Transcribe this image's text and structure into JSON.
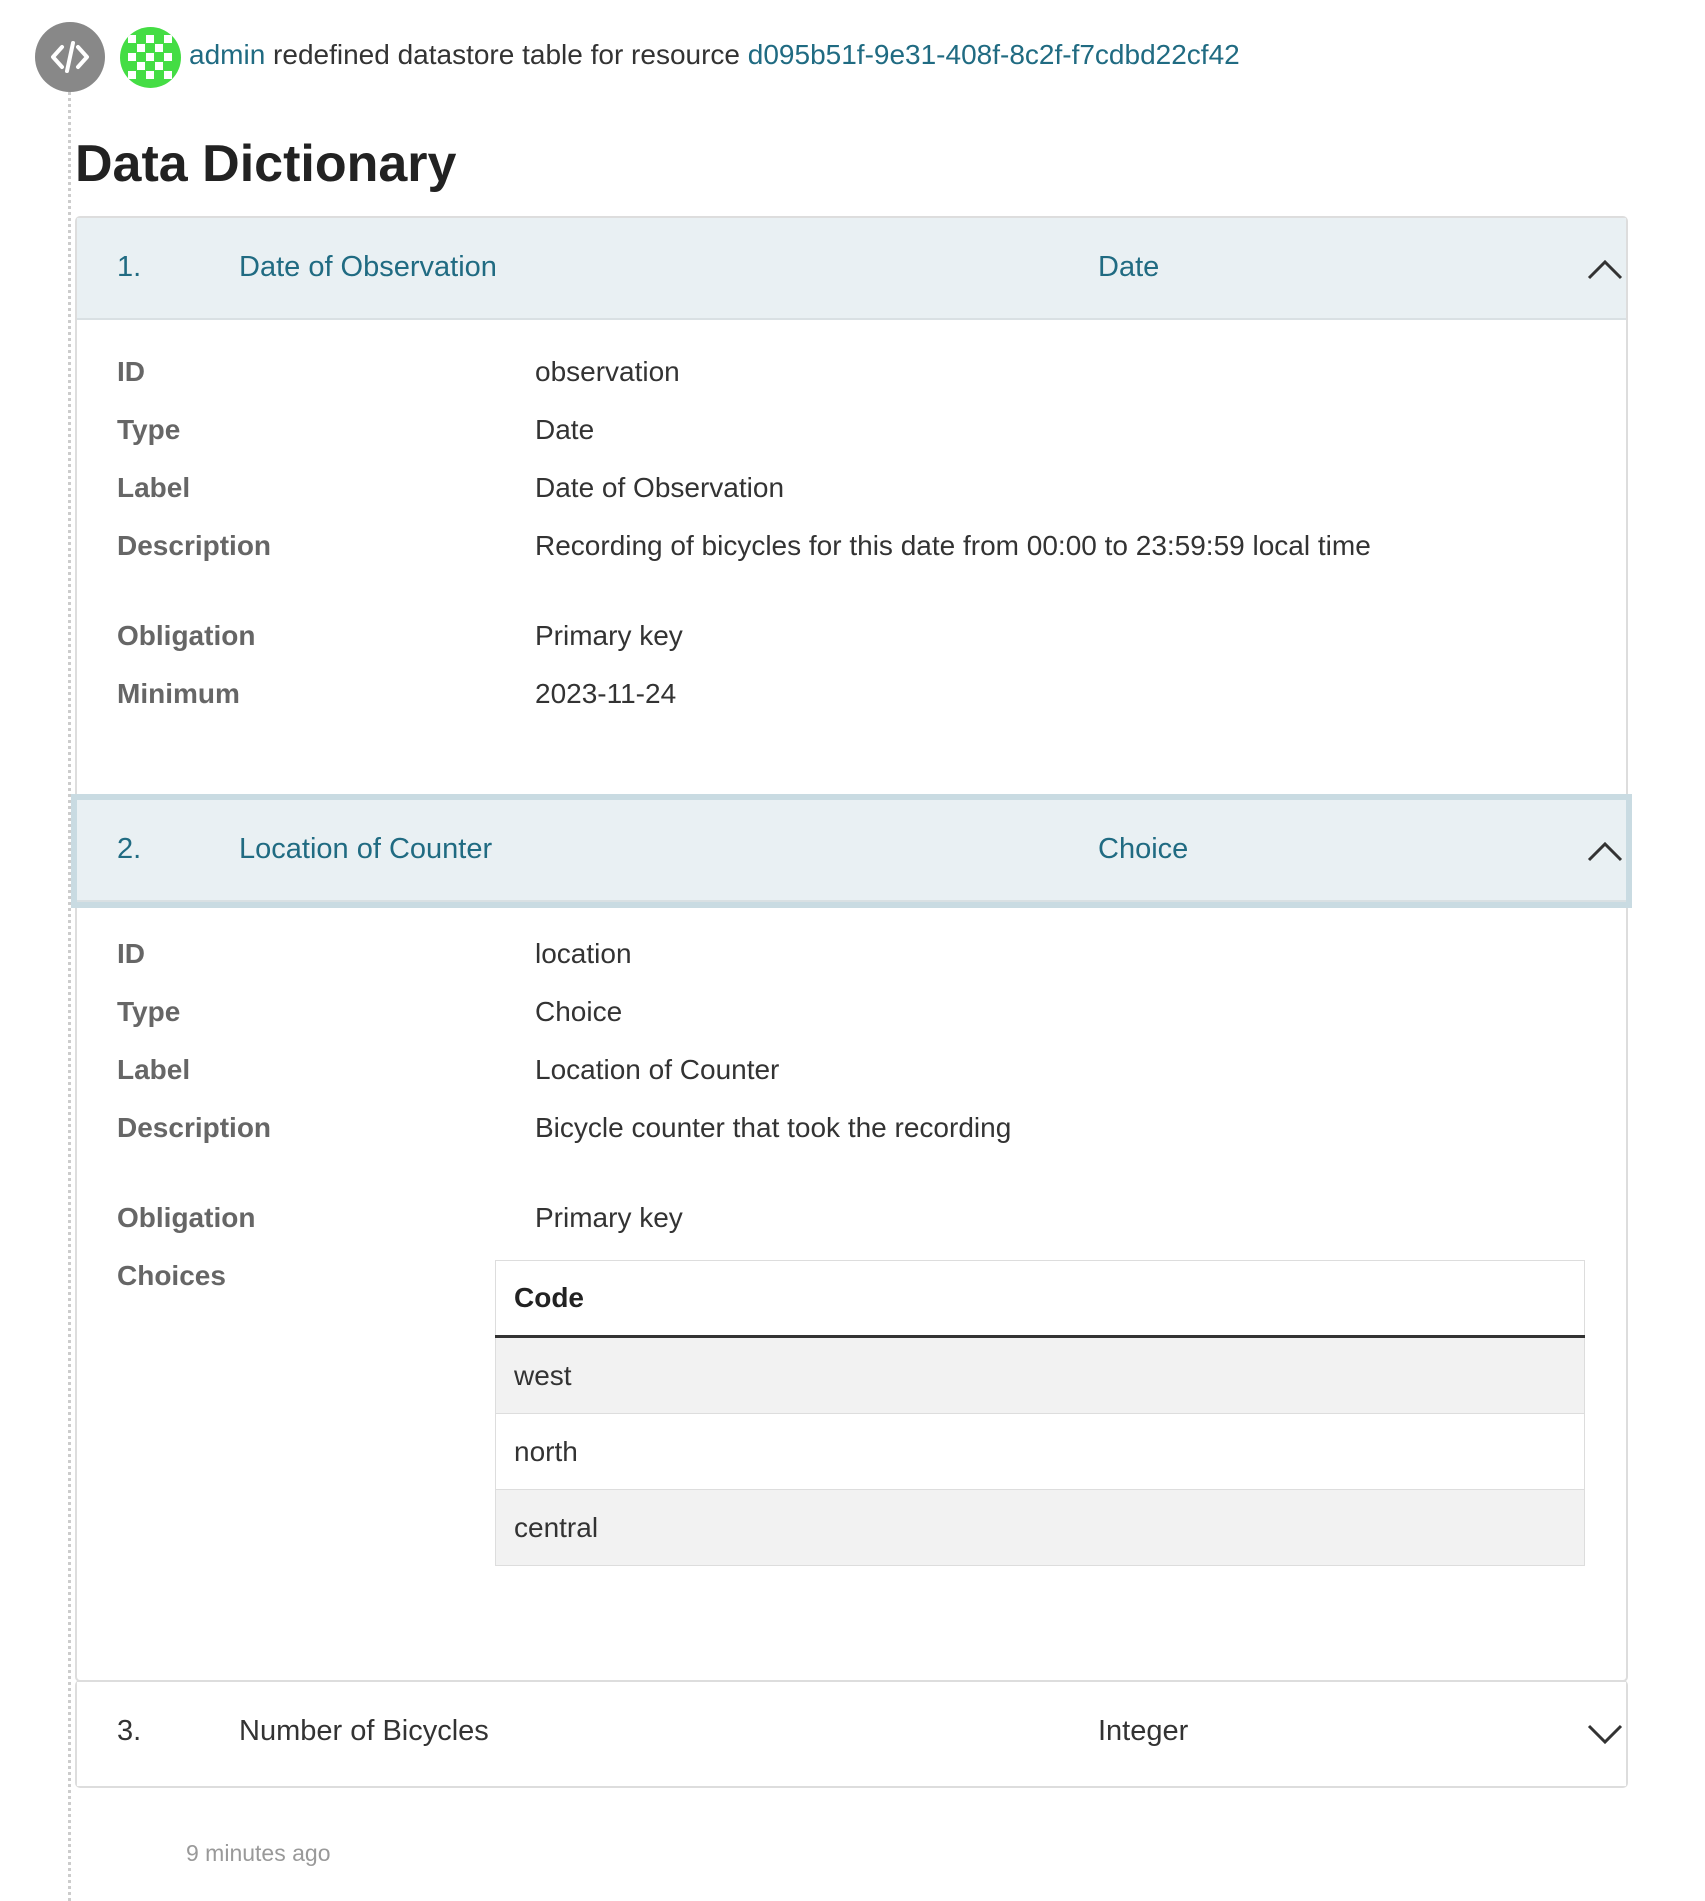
{
  "activity": {
    "icon": "code-icon",
    "avatar": "user-avatar",
    "actor": "admin",
    "action": "redefined datastore table for resource",
    "resource_id": "d095b51f-9e31-408f-8c2f-f7cdbd22cf42",
    "timestamp": "9 minutes ago"
  },
  "page_title": "Data Dictionary",
  "fields": [
    {
      "number": "1.",
      "label": "Date of Observation",
      "type": "Date",
      "expanded": true,
      "props": {
        "id_key": "ID",
        "id_val": "observation",
        "type_key": "Type",
        "type_val": "Date",
        "label_key": "Label",
        "label_val": "Date of Observation",
        "desc_key": "Description",
        "desc_val": "Recording of bicycles for this date from 00:00 to 23:59:59 local time",
        "obl_key": "Obligation",
        "obl_val": "Primary key",
        "min_key": "Minimum",
        "min_val": "2023-11-24"
      }
    },
    {
      "number": "2.",
      "label": "Location of Counter",
      "type": "Choice",
      "expanded": true,
      "props": {
        "id_key": "ID",
        "id_val": "location",
        "type_key": "Type",
        "type_val": "Choice",
        "label_key": "Label",
        "label_val": "Location of Counter",
        "desc_key": "Description",
        "desc_val": "Bicycle counter that took the recording",
        "obl_key": "Obligation",
        "obl_val": "Primary key",
        "choices_key": "Choices"
      },
      "choices_table": {
        "header": "Code",
        "rows": [
          "west",
          "north",
          "central"
        ]
      }
    },
    {
      "number": "3.",
      "label": "Number of Bicycles",
      "type": "Integer",
      "expanded": false
    }
  ],
  "colors": {
    "link": "#206b82",
    "header_bg": "#e9f0f3",
    "avatar": "#44dd44"
  }
}
